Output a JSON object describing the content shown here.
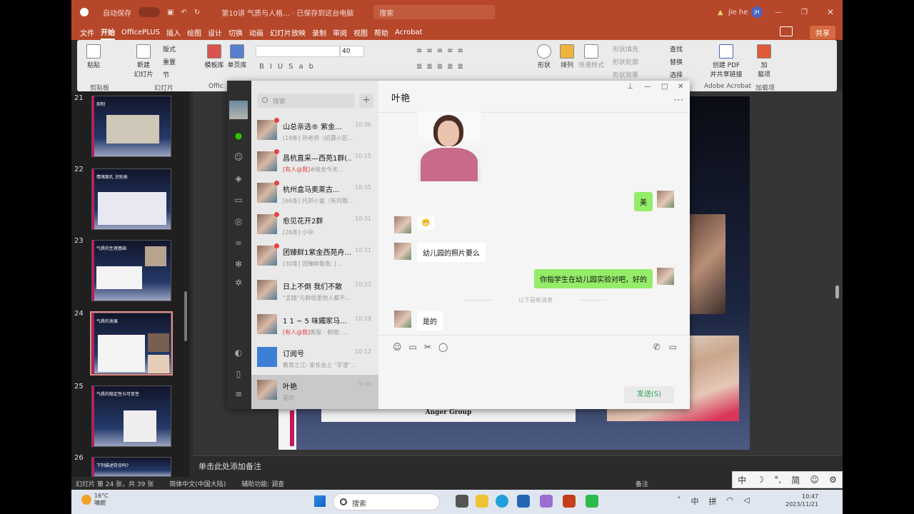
{
  "titlebar": {
    "autosave": "自动保存",
    "doc_title": "第10讲 气质与人格...  · 已保存到这台电脑",
    "search": "搜索",
    "user": "jie he",
    "user_initials": "JH"
  },
  "menu": [
    "文件",
    "开始",
    "OfficePLUS",
    "插入",
    "绘图",
    "设计",
    "切换",
    "动画",
    "幻灯片放映",
    "录制",
    "审阅",
    "视图",
    "帮助",
    "Acrobat"
  ],
  "share_label": "共享",
  "ribbon": {
    "paste": "粘贴",
    "clipboard": "剪贴板",
    "new_slide": "新建\n幻灯片",
    "layout": "版式",
    "reset": "重置",
    "section": "节",
    "slides_group": "幻灯片",
    "template": "模板库",
    "single_page": "单页库",
    "office_group": "Offic",
    "font_size": "40",
    "shape": "形状",
    "arrange": "排列",
    "quick_style": "快速样式",
    "shape_fill": "形状填充",
    "shape_outline": "形状轮廓",
    "shape_effect": "形状效果",
    "find": "查找",
    "replace": "替换",
    "select": "选择",
    "create_pdf": "创建 PDF\n并共享链接",
    "adobe": "Adobe Acrobat",
    "addins": "加\n载项",
    "addins_group": "加载项"
  },
  "thumbnails": [
    {
      "num": "21",
      "title": "抑制"
    },
    {
      "num": "22",
      "title": "情绪面孔 识别表"
    },
    {
      "num": "23",
      "title": "气质的生理基础"
    },
    {
      "num": "24",
      "title": "气质的发展"
    },
    {
      "num": "25",
      "title": "气质的稳定性与可变性"
    },
    {
      "num": "26",
      "title": "下列描述符合吗?"
    }
  ],
  "slide": {
    "caption": "Anger Group"
  },
  "notes_placeholder": "单击此处添加备注",
  "status": {
    "slide_info": "幻灯片 第 24 张，共 39 张",
    "language": "简体中文(中国大陆)",
    "accessibility": "辅助功能: 调查",
    "notes": "备注"
  },
  "wechat": {
    "search_placeholder": "搜索",
    "chat_title": "叶艳",
    "conversations": [
      {
        "name": "山总亲选® 紫金...",
        "time": "10:36",
        "preview": "[19条] 孙老师（招募小区...",
        "mention": ""
      },
      {
        "name": "昌杭直采—西苑1群(...",
        "time": "10:15",
        "preview": "#接龙今天...",
        "mention": "[有人@我]"
      },
      {
        "name": "杭州盒马奥莱古...",
        "time": "10:35",
        "preview": "[66条] 托邦小盒（有问题...",
        "mention": ""
      },
      {
        "name": "愈见花开2群",
        "time": "10:31",
        "preview": "[26条] 小孕",
        "mention": ""
      },
      {
        "name": "团臻鲜1紫金西苑舟...",
        "time": "10:31",
        "preview": "[30条] 团臻鲜鲁南: [...",
        "mention": ""
      },
      {
        "name": "日上不倒 我们不散",
        "time": "10:22",
        "preview": "\"言路\"与群组里他人都不...",
        "mention": ""
      },
      {
        "name": "1 1 ~ 5 味鐲家马...",
        "time": "10:19",
        "preview": "客服 - 朝南: ...",
        "mention": "[有人@我]"
      },
      {
        "name": "订阅号",
        "time": "10:12",
        "preview": "教育之江: 家长会上 \"学渣\"...",
        "mention": ""
      },
      {
        "name": "叶艳",
        "time": "9:46",
        "preview": "是的",
        "mention": ""
      }
    ],
    "messages": {
      "me_1": "美",
      "them_emoji": "😬",
      "them_1": "幼儿园的照片要么",
      "me_2": "你指学生在幼儿园实验对吧，好的",
      "divider": "以下是新消息",
      "them_2": "是的"
    },
    "send_label": "发送(S)"
  },
  "taskbar": {
    "temp": "16°C",
    "weather": "晴朗",
    "search": "搜索",
    "ime_1": "中",
    "ime_2": "拼",
    "time": "10:47",
    "date": "2023/11/21"
  },
  "ime_bar": [
    "中",
    "☽",
    "°,",
    "简",
    "☺",
    "⚙"
  ]
}
